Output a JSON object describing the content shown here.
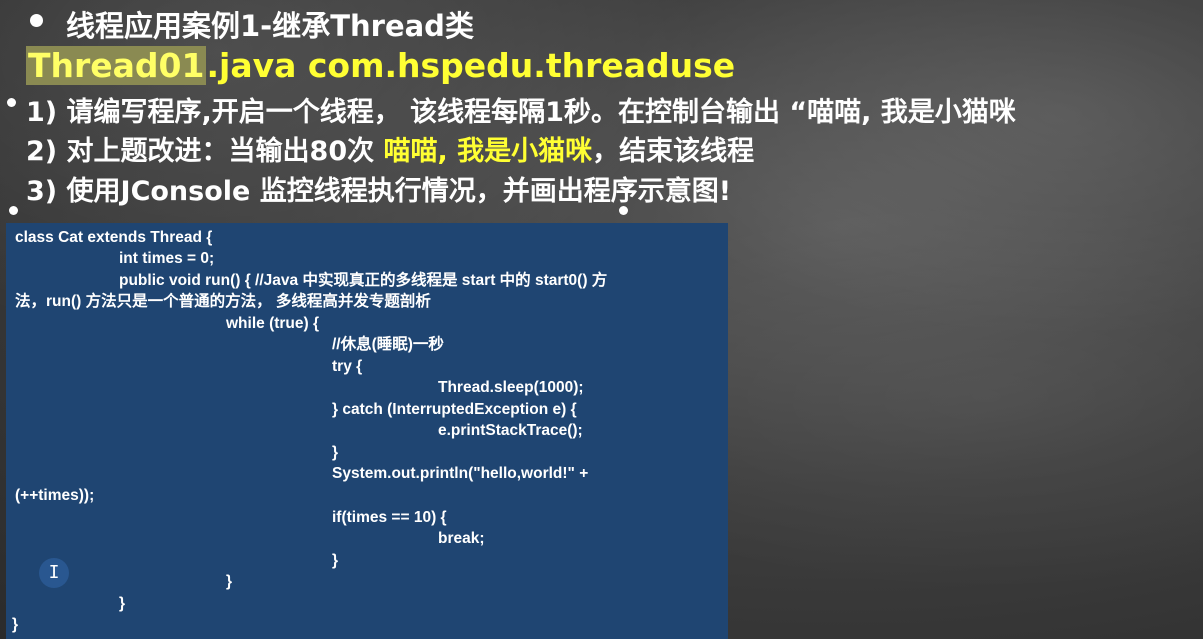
{
  "slide": {
    "title": "线程应用案例1-继承Thread类",
    "file": {
      "name_highlight": "Thread01",
      "name_rest": ".java com.hspedu.threaduse"
    },
    "items": [
      {
        "text": "1) 请编写程序,开启一个线程， 该线程每隔1秒。在控制台输出 “喵喵, 我是小猫咪",
        "highlight": "",
        "suffix": ""
      },
      {
        "text": "2) 对上题改进：当输出80次 ",
        "highlight": "喵喵, 我是小猫咪",
        "suffix": "，结束该线程"
      },
      {
        "text": "3) 使用JConsole 监控线程执行情况，并画出程序示意图!",
        "highlight": "",
        "suffix": ""
      }
    ]
  },
  "code": {
    "lines": [
      "class Cat extends Thread {",
      "int times = 0;",
      "public void run() { //Java 中实现真正的多线程是 start 中的 start0() 方",
      "法，run() 方法只是一个普通的方法， 多线程高并发专题剖析",
      "while (true) {",
      "//休息(睡眠)一秒",
      "try {",
      "Thread.sleep(1000);",
      "} catch (InterruptedException e) {",
      "e.printStackTrace();",
      "}",
      "System.out.println(\"hello,world!\" +",
      "(++times));",
      "if(times == 10) {",
      "break;",
      "}",
      "}",
      "}",
      "}"
    ]
  },
  "colors": {
    "code_bg": "#1f4572",
    "highlight_text": "#ffff33",
    "board_bg": "#3f3f3f"
  },
  "cursor": "text-cursor-icon"
}
